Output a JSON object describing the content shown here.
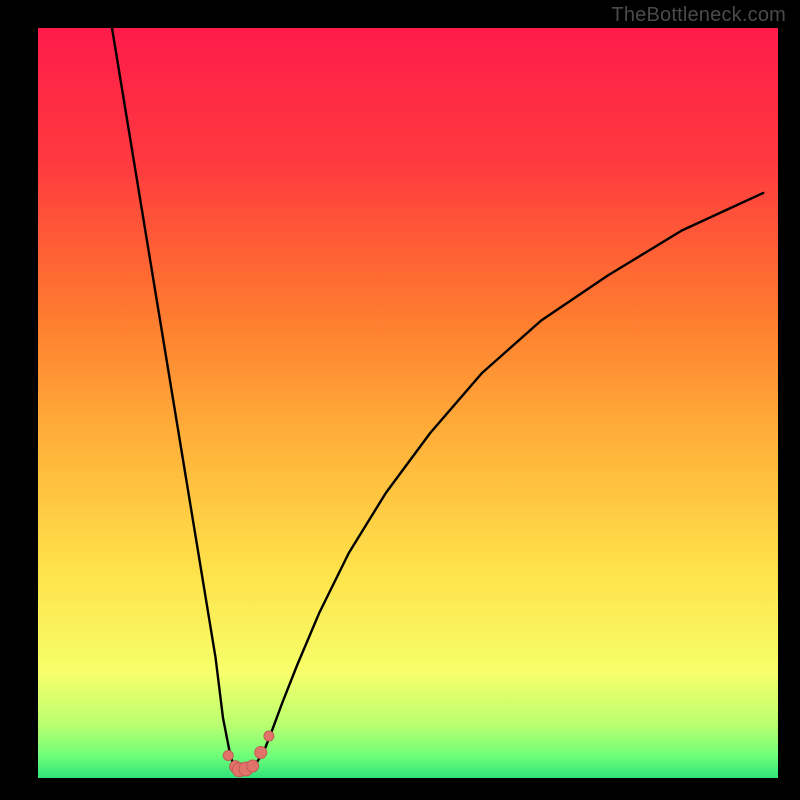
{
  "watermark": "TheBottleneck.com",
  "colors": {
    "frame": "#000000",
    "curve_stroke": "#000000",
    "marker_fill": "#e2736b",
    "marker_stroke": "#c25a54",
    "bottom_band": "#2fe47a"
  },
  "chart_data": {
    "type": "line",
    "title": "",
    "xlabel": "",
    "ylabel": "",
    "xlim": [
      0,
      100
    ],
    "ylim": [
      0,
      100
    ],
    "gradient_stops": [
      {
        "pct": 0,
        "color": "#ff1b4a"
      },
      {
        "pct": 18,
        "color": "#ff3a3f"
      },
      {
        "pct": 38,
        "color": "#ff7a2f"
      },
      {
        "pct": 55,
        "color": "#ffb13a"
      },
      {
        "pct": 72,
        "color": "#ffe14a"
      },
      {
        "pct": 86,
        "color": "#f7ff6a"
      },
      {
        "pct": 93,
        "color": "#b8ff70"
      },
      {
        "pct": 97,
        "color": "#70ff78"
      },
      {
        "pct": 100,
        "color": "#2fe47a"
      }
    ],
    "series": [
      {
        "name": "bottleneck-curve",
        "x": [
          10,
          12,
          14,
          16,
          18,
          20,
          22,
          24,
          25,
          26,
          26.5,
          27,
          27.7,
          28.5,
          29.5,
          30.5,
          31.5,
          33,
          35,
          38,
          42,
          47,
          53,
          60,
          68,
          77,
          87,
          98
        ],
        "y": [
          100,
          88,
          76,
          64,
          52,
          40,
          28,
          16,
          8,
          3,
          1.5,
          1,
          1.2,
          1.5,
          2,
          3.5,
          6,
          10,
          15,
          22,
          30,
          38,
          46,
          54,
          61,
          67,
          73,
          78
        ]
      }
    ],
    "markers": [
      {
        "x": 25.7,
        "y": 3.0,
        "r": 5
      },
      {
        "x": 26.7,
        "y": 1.5,
        "r": 6
      },
      {
        "x": 27.2,
        "y": 1.1,
        "r": 7
      },
      {
        "x": 28.1,
        "y": 1.2,
        "r": 7
      },
      {
        "x": 29.0,
        "y": 1.6,
        "r": 6
      },
      {
        "x": 30.1,
        "y": 3.4,
        "r": 6
      },
      {
        "x": 31.2,
        "y": 5.6,
        "r": 5
      }
    ]
  }
}
